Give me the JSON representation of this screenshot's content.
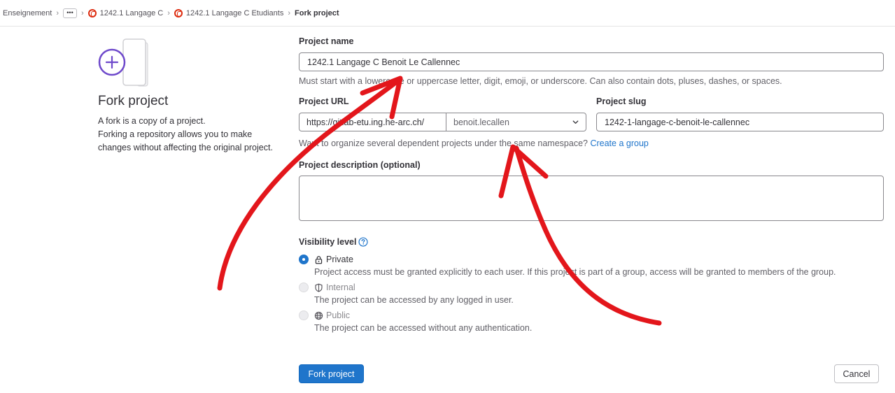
{
  "breadcrumb": {
    "items": [
      {
        "label": "Enseignement"
      },
      {
        "label": "1242.1 Langage C"
      },
      {
        "label": "1242.1 Langage C Etudiants"
      },
      {
        "label": "Fork project"
      }
    ],
    "more_label": "•••",
    "separator": "›"
  },
  "left": {
    "title": "Fork project",
    "desc_line1": "A fork is a copy of a project.",
    "desc_line2": "Forking a repository allows you to make changes without affecting the original project."
  },
  "form": {
    "project_name_label": "Project name",
    "project_name_value": "1242.1 Langage C Benoit Le Callennec",
    "project_name_hint": "Must start with a lowercase or uppercase letter, digit, emoji, or underscore. Can also contain dots, pluses, dashes, or spaces.",
    "project_url_label": "Project URL",
    "project_url_prefix": "https://gitlab-etu.ing.he-arc.ch/",
    "namespace_value": "benoit.lecallen",
    "project_slug_label": "Project slug",
    "project_slug_value": "1242-1-langage-c-benoit-le-callennec",
    "namespace_hint": "Want to organize several dependent projects under the same namespace?",
    "create_group_link": "Create a group",
    "description_label": "Project description (optional)",
    "description_value": "",
    "visibility_label": "Visibility level",
    "visibility_options": [
      {
        "label": "Private",
        "help": "Project access must be granted explicitly to each user. If this project is part of a group, access will be granted to members of the group.",
        "icon": "lock-icon",
        "checked": true,
        "disabled": false
      },
      {
        "label": "Internal",
        "help": "The project can be accessed by any logged in user.",
        "icon": "shield-icon",
        "checked": false,
        "disabled": true
      },
      {
        "label": "Public",
        "help": "The project can be accessed without any authentication.",
        "icon": "globe-icon",
        "checked": false,
        "disabled": true
      }
    ],
    "submit_label": "Fork project",
    "cancel_label": "Cancel"
  },
  "colors": {
    "primary": "#1f75cb",
    "annotation_arrow": "#e3161b",
    "illustration_accent": "#6e49cb"
  }
}
